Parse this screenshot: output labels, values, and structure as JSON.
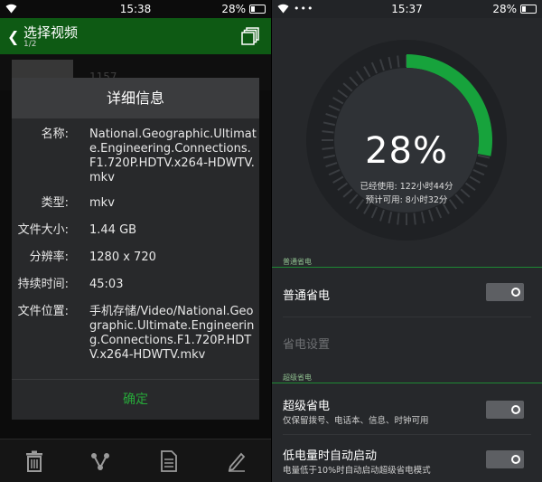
{
  "left_status": {
    "time": "15:38",
    "battery": "28%"
  },
  "right_status": {
    "time": "15:37",
    "battery": "28%",
    "indicators": "•••"
  },
  "appbar": {
    "title": "选择视频",
    "subtitle": "1/2"
  },
  "video_item": {
    "number": "1157"
  },
  "dialog": {
    "title": "详细信息",
    "rows": [
      {
        "label": "名称:",
        "value": "National.Geographic.Ultimate.Engineering.Connections.F1.720P.HDTV.x264-HDWTV.mkv"
      },
      {
        "label": "类型:",
        "value": "mkv"
      },
      {
        "label": "文件大小:",
        "value": "1.44 GB"
      },
      {
        "label": "分辨率:",
        "value": "1280 x 720"
      },
      {
        "label": "持续时间:",
        "value": "45:03"
      },
      {
        "label": "文件位置:",
        "value": "手机存储/Video/National.Geographic.Ultimate.Engineering.Connections.F1.720P.HDTV.x264-HDWTV.mkv"
      }
    ],
    "ok_label": "确定"
  },
  "bottom_bar": {
    "icons": [
      "trash-icon",
      "share-icon",
      "document-icon",
      "edit-icon"
    ]
  },
  "battery_gauge": {
    "percent_text": "28%",
    "percent_value": 0.28,
    "used_line": "已经使用:  122小时44分",
    "remaining_line": "预计可用:  8小时32分",
    "accent_color": "#17a33c"
  },
  "sections": {
    "normal_header": "普通省电",
    "super_header": "超级省电"
  },
  "settings": {
    "normal_title": "普通省电",
    "power_settings": "省电设置",
    "super_title": "超级省电",
    "super_sub": "仅保留拨号、电话本、信息、时钟可用",
    "auto_title": "低电量时自动启动",
    "auto_sub": "电量低于10%时自动启动超级省电模式"
  }
}
